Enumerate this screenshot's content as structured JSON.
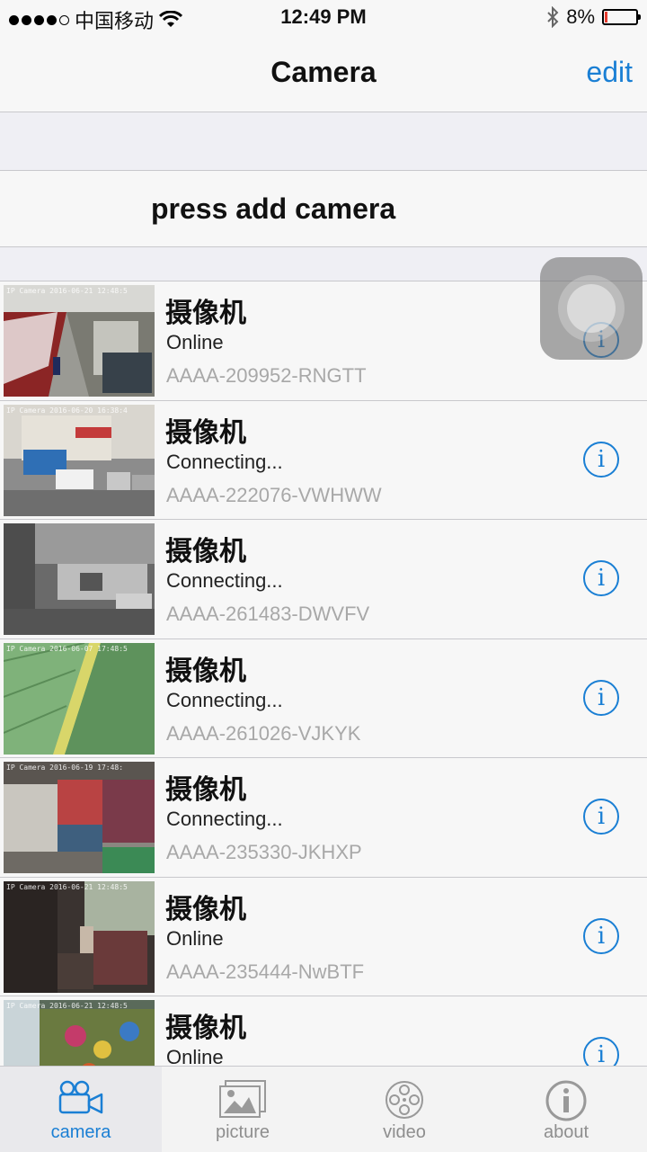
{
  "status_bar": {
    "carrier": "中国移动",
    "time": "12:49 PM",
    "battery": "8%",
    "battery_level": 0.08
  },
  "nav": {
    "title": "Camera",
    "edit_label": "edit"
  },
  "add_prompt": "press add camera",
  "cameras": [
    {
      "name": "摄像机",
      "status": "Online",
      "id": "AAAA-209952-RNGTT",
      "stamp": "IP Camera  2016-06-21 12:48:5"
    },
    {
      "name": "摄像机",
      "status": "Connecting...",
      "id": "AAAA-222076-VWHWW",
      "stamp": "IP Camera  2016-06-20 16:38:4"
    },
    {
      "name": "摄像机",
      "status": "Connecting...",
      "id": "AAAA-261483-DWVFV",
      "stamp": ""
    },
    {
      "name": "摄像机",
      "status": "Connecting...",
      "id": "AAAA-261026-VJKYK",
      "stamp": "IP Camera  2016-06-07 17:48:5"
    },
    {
      "name": "摄像机",
      "status": "Connecting...",
      "id": "AAAA-235330-JKHXP",
      "stamp": "IP Camera  2016-06-19 17:48:"
    },
    {
      "name": "摄像机",
      "status": "Online",
      "id": "AAAA-235444-NwBTF",
      "stamp": "IP Camera  2016-06-21 12:48:5"
    },
    {
      "name": "摄像机",
      "status": "Online",
      "id": "",
      "stamp": "IP Camera  2016-06-21 12:48:5"
    }
  ],
  "tabs": [
    {
      "label": "camera",
      "icon": "camera-icon",
      "active": true
    },
    {
      "label": "picture",
      "icon": "picture-icon",
      "active": false
    },
    {
      "label": "video",
      "icon": "film-reel-icon",
      "active": false
    },
    {
      "label": "about",
      "icon": "info-icon",
      "active": false
    }
  ],
  "colors": {
    "accent": "#1a7fd4",
    "battery_low": "#e63b2e"
  }
}
